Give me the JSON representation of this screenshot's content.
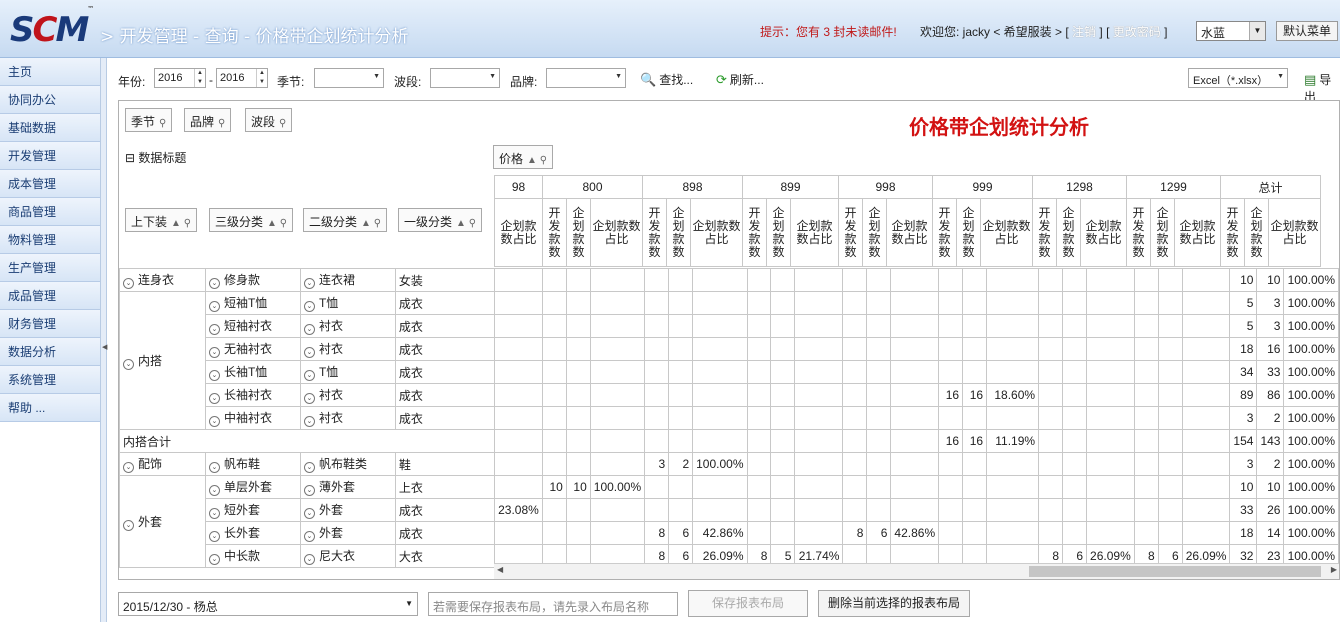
{
  "header": {
    "logo_a": "S",
    "logo_b": "C",
    "logo_c": "M",
    "logo_tm": "™",
    "title": "> 开发管理 - 查询 - 价格带企划统计分析",
    "notice": "提示：您有 3 封未读邮件!",
    "welcome": "欢迎您: jacky < 希望服装 > [",
    "logout": "注销",
    "sep": "] [",
    "change_pwd": "更改密码",
    "close": "]",
    "skin": "水蓝",
    "default_menu": "默认菜单"
  },
  "sidebar": {
    "items": [
      "主页",
      "协同办公",
      "基础数据",
      "开发管理",
      "成本管理",
      "商品管理",
      "物料管理",
      "生产管理",
      "成品管理",
      "财务管理",
      "数据分析",
      "系统管理",
      "帮助 ..."
    ]
  },
  "toolbar": {
    "year_label": "年份:",
    "year_from": "2016",
    "dash": "-",
    "year_to": "2016",
    "season_label": "季节:",
    "season_value": "",
    "band_label": "波段:",
    "band_value": "",
    "brand_label": "品牌:",
    "brand_value": "",
    "find": "查找...",
    "refresh": "刷新...",
    "export_format": "Excel（*.xlsx）",
    "export": "导出"
  },
  "report": {
    "filter_chips": [
      "季节",
      "品牌",
      "波段"
    ],
    "title": "价格带企划统计分析",
    "data_title": "数据标题",
    "price_chip": "价格",
    "row_chips": [
      "上下装",
      "三级分类",
      "二级分类",
      "一级分类"
    ],
    "price_bands": [
      "98",
      "800",
      "898",
      "899",
      "998",
      "999",
      "1298",
      "1299",
      "总计"
    ],
    "col_dev": "开发款数",
    "col_plan": "企划款数",
    "col_ratio": "企划款数占比",
    "rows": [
      {
        "g": "连身衣",
        "c3": "修身款",
        "c2": "连衣裙",
        "c1": "女装",
        "v": {
          "total": [
            "10",
            "10",
            "100.00%"
          ]
        }
      },
      {
        "g": "内搭",
        "c3": "短袖T恤",
        "c2": "T恤",
        "c1": "成衣",
        "v": {
          "total": [
            "5",
            "3",
            "100.00%"
          ]
        }
      },
      {
        "g": "",
        "c3": "短袖衬衣",
        "c2": "衬衣",
        "c1": "成衣",
        "v": {
          "total": [
            "5",
            "3",
            "100.00%"
          ]
        }
      },
      {
        "g": "",
        "c3": "无袖衬衣",
        "c2": "衬衣",
        "c1": "成衣",
        "v": {
          "total": [
            "18",
            "16",
            "100.00%"
          ]
        }
      },
      {
        "g": "",
        "c3": "长袖T恤",
        "c2": "T恤",
        "c1": "成衣",
        "v": {
          "total": [
            "34",
            "33",
            "100.00%"
          ]
        }
      },
      {
        "g": "",
        "c3": "长袖衬衣",
        "c2": "衬衣",
        "c1": "成衣",
        "v": {
          "999": [
            "16",
            "16",
            "18.60%"
          ],
          "total": [
            "89",
            "86",
            "100.00%"
          ]
        }
      },
      {
        "g": "",
        "c3": "中袖衬衣",
        "c2": "衬衣",
        "c1": "成衣",
        "v": {
          "total": [
            "3",
            "2",
            "100.00%"
          ]
        }
      },
      {
        "subtotal": "内搭合计",
        "v": {
          "999": [
            "16",
            "16",
            "11.19%"
          ],
          "total": [
            "154",
            "143",
            "100.00%"
          ]
        }
      },
      {
        "g": "配饰",
        "c3": "帆布鞋",
        "c2": "帆布鞋类",
        "c1": "鞋",
        "v": {
          "898": [
            "3",
            "2",
            "100.00%"
          ],
          "total": [
            "3",
            "2",
            "100.00%"
          ]
        }
      },
      {
        "g": "外套",
        "c3": "单层外套",
        "c2": "薄外套",
        "c1": "上衣",
        "v": {
          "800": [
            "10",
            "10",
            "100.00%"
          ],
          "total": [
            "10",
            "10",
            "100.00%"
          ]
        }
      },
      {
        "g": "",
        "c3": "短外套",
        "c2": "外套",
        "c1": "成衣",
        "v": {
          "98": [
            "",
            "",
            "23.08%"
          ],
          "total": [
            "33",
            "26",
            "100.00%"
          ]
        }
      },
      {
        "g": "",
        "c3": "长外套",
        "c2": "外套",
        "c1": "成衣",
        "v": {
          "898": [
            "8",
            "6",
            "42.86%"
          ],
          "998": [
            "8",
            "6",
            "42.86%"
          ],
          "total": [
            "18",
            "14",
            "100.00%"
          ]
        }
      },
      {
        "g": "",
        "c3": "中长款",
        "c2": "尼大衣",
        "c1": "大衣",
        "v": {
          "898": [
            "8",
            "6",
            "26.09%"
          ],
          "899": [
            "8",
            "5",
            "21.74%"
          ],
          "1298": [
            "8",
            "6",
            "26.09%"
          ],
          "1299": [
            "8",
            "6",
            "26.09%"
          ],
          "total": [
            "32",
            "23",
            "100.00%"
          ]
        }
      }
    ]
  },
  "footer": {
    "layout_select": "2015/12/30 - 杨总",
    "layout_name_placeholder": "若需要保存报表布局，请先录入布局名称",
    "save_layout": "保存报表布局",
    "delete_layout": "删除当前选择的报表布局"
  }
}
